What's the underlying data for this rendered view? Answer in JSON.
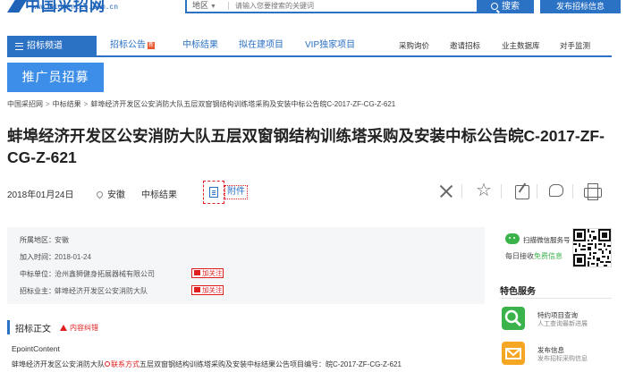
{
  "site": {
    "logo_text": "中国采招网",
    "logo_url": "www.bidcenter.com.cn"
  },
  "search": {
    "region_label": "地区",
    "placeholder": "请输入您要搜索的关键词",
    "button_label": "搜索",
    "publish_label": "发布招标信息"
  },
  "nav": {
    "home_label": "招标频道",
    "items": [
      "招标公告",
      "中标结果",
      "拟在建项目",
      "VIP独家项目",
      "采购询价",
      "邀请招标",
      "业主数据库",
      "对手监测"
    ],
    "hot_badge": "新"
  },
  "promo": {
    "label": "推广员招募"
  },
  "breadcrumb": [
    "中国采招网",
    "中标结果",
    "蚌埠经济开发区公安消防大队五层双窗钢结构训练塔采购及安装中标公告皖C-2017-ZF-CG-Z-621"
  ],
  "article": {
    "title": "蚌埠经济开发区公安消防大队五层双窗钢结构训练塔采购及安装中标公告皖C-2017-ZF-CG-Z-621",
    "date": "2018年01月24日",
    "location": "安徽",
    "type": "中标结果",
    "attachment_label": "附件"
  },
  "info": {
    "region_label": "所属地区：",
    "region_value": "安徽",
    "time_label": "加入时间：",
    "time_value": "2018-01-24",
    "winner_label": "中标单位：",
    "winner_value": "沧州鑫狮健身拓展器械有限公司",
    "owner_label": "招标业主：",
    "owner_value": "蚌埠经济开发区公安消防大队",
    "follow_label": "加关注"
  },
  "body": {
    "heading": "招标正文",
    "correct_label": "内容纠错",
    "epoint": "EpointContent",
    "text_prefix": "蚌埠经济开发区公安消防大队",
    "contact_label": "联系方式",
    "text_suffix": "五层双窗钢结构训练塔采购及安装中标结果公告项目编号：皖C-2017-ZF-CG-Z-621"
  },
  "sidebar": {
    "wechat_title": "扫描微信服务号",
    "wechat_sub_prefix": "每日接收",
    "wechat_sub_highlight": "免费信息",
    "feature_heading": "特色服务",
    "features": [
      {
        "title": "特约项目查询",
        "sub": "人工查询最新进展",
        "icon": "magnifier-icon",
        "color": "#3ab34a"
      },
      {
        "title": "发布信息",
        "sub": "发布招标采购信息",
        "icon": "envelope-icon",
        "color": "#f5a623"
      }
    ]
  },
  "colors": {
    "brand_blue": "#2b71c4",
    "promo_blue": "#3c8ee8",
    "alert_red": "#e02020",
    "wechat_green": "#3ab34a"
  }
}
